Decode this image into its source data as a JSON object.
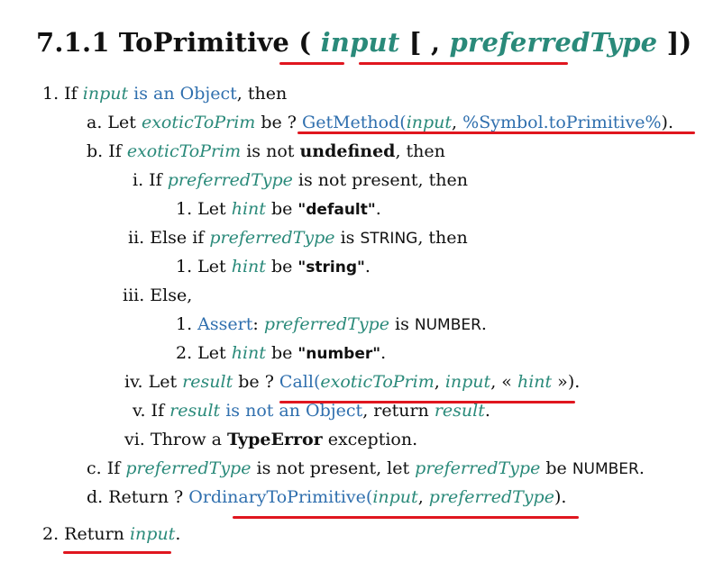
{
  "section": {
    "number": "7.1.1",
    "name": "ToPrimitive",
    "open_paren": "(",
    "arg1": "input",
    "open_bracket": "[",
    "comma": ",",
    "arg2": "preferredType",
    "close_bracket": "]",
    "close_paren": ")"
  },
  "steps": {
    "s1": {
      "prefix": "1. If ",
      "var": "input",
      "link": " is an Object",
      "rest": ", then"
    },
    "s1a": {
      "prefix": "a. Let ",
      "var": "exoticToPrim",
      "mid": " be ? ",
      "fn": "GetMethod",
      "open": "(",
      "arg": "input",
      "sep": ", ",
      "sym": "%Symbol.toPrimitive%",
      "close": ")",
      "end": "."
    },
    "s1b": {
      "prefix": "b. If ",
      "var": "exoticToPrim",
      "mid": " is not ",
      "kw": "undefined",
      "rest": ", then"
    },
    "s1bi": {
      "prefix": "i. If ",
      "var": "preferredType",
      "rest": " is not present, then"
    },
    "s1bi1": {
      "prefix": "1. Let ",
      "var": "hint",
      "mid": " be ",
      "val": "\"default\"",
      "end": "."
    },
    "s1bii": {
      "prefix": "ii. Else if ",
      "var": "preferredType",
      "mid": " is ",
      "const": "STRING",
      "rest": ", then"
    },
    "s1bii1": {
      "prefix": "1. Let ",
      "var": "hint",
      "mid": " be ",
      "val": "\"string\"",
      "end": "."
    },
    "s1biii": {
      "text": "iii. Else,"
    },
    "s1biii1": {
      "prefix": "1. ",
      "link": "Assert",
      "colon": ": ",
      "var": "preferredType",
      "mid": " is ",
      "const": "NUMBER",
      "end": "."
    },
    "s1biii2": {
      "prefix": "2. Let ",
      "var": "hint",
      "mid": " be ",
      "val": "\"number\"",
      "end": "."
    },
    "s1biv": {
      "prefix": "iv. Let ",
      "var": "result",
      "mid": " be ? ",
      "fn": "Call",
      "open": "(",
      "arg1": "exoticToPrim",
      "sep1": ", ",
      "arg2": "input",
      "sep2": ", ",
      "lq": "« ",
      "arg3": "hint",
      "rq": " »",
      "close": ")",
      "end": "."
    },
    "s1bv": {
      "prefix": "v. If ",
      "var": "result",
      "link": " is not an Object",
      "mid": ", return ",
      "var2": "result",
      "end": "."
    },
    "s1bvi": {
      "prefix": "vi. Throw a ",
      "kw": "TypeError",
      "rest": " exception."
    },
    "s1c": {
      "prefix": "c. If ",
      "var": "preferredType",
      "mid": " is not present, let ",
      "var2": "preferredType",
      "mid2": " be ",
      "const": "NUMBER",
      "end": "."
    },
    "s1d": {
      "prefix": "d. Return ? ",
      "fn": "OrdinaryToPrimitive",
      "open": "(",
      "arg1": "input",
      "sep": ", ",
      "arg2": "preferredType",
      "close": ")",
      "end": "."
    },
    "s2": {
      "prefix": "2. ",
      "ret": "Return",
      "sp": " ",
      "var": "input",
      "end": "."
    }
  },
  "annotation_color": "#e0161f",
  "variable_color": "#2a8a7a",
  "link_color": "#2f6fae"
}
